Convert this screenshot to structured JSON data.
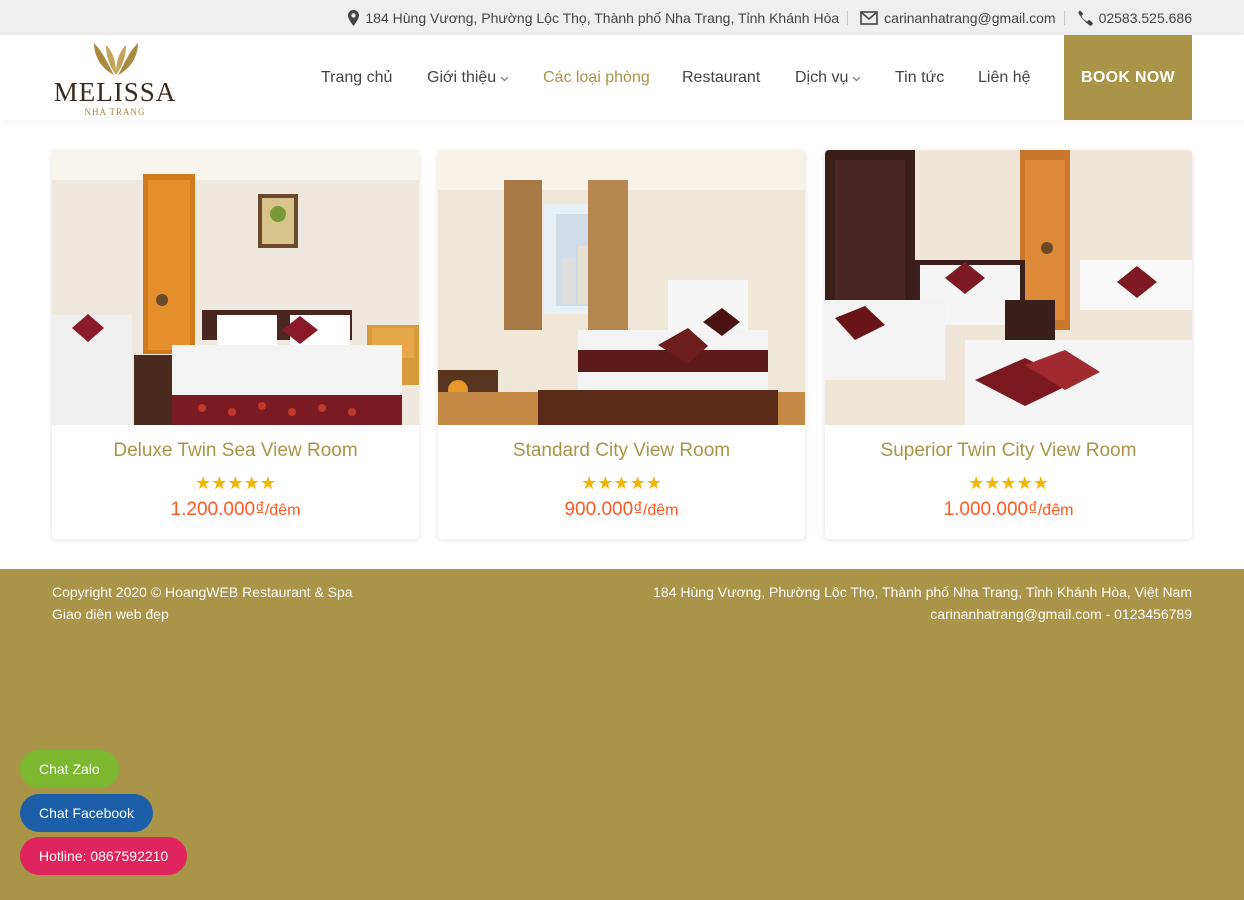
{
  "topbar": {
    "address": "184 Hùng Vương, Phường Lộc Thọ, Thành phố Nha Trang, Tỉnh Khánh Hòa",
    "email": "carinanhatrang@gmail.com",
    "phone": "02583.525.686",
    "icons": [
      "map-marker-icon",
      "envelope-icon",
      "phone-icon"
    ]
  },
  "logo": {
    "name": "MELISSA",
    "subtitle": "NHA TRANG"
  },
  "nav": {
    "items": [
      {
        "label": "Trang chủ",
        "active": false,
        "dropdown": false
      },
      {
        "label": "Giới thiệu",
        "active": false,
        "dropdown": true
      },
      {
        "label": "Các loại phòng",
        "active": true,
        "dropdown": false
      },
      {
        "label": "Restaurant",
        "active": false,
        "dropdown": false
      },
      {
        "label": "Dịch vụ",
        "active": false,
        "dropdown": true
      },
      {
        "label": "Tin tức",
        "active": false,
        "dropdown": false
      },
      {
        "label": "Liên hệ",
        "active": false,
        "dropdown": false
      }
    ],
    "book_label": "BOOK NOW"
  },
  "rooms": [
    {
      "title": "Deluxe Twin Sea View Room",
      "rating": 5,
      "max_rating": 5,
      "price": "1.200.000₫",
      "unit": "/đêm"
    },
    {
      "title": "Standard City View Room",
      "rating": 5,
      "max_rating": 5,
      "price": "900.000₫",
      "unit": "/đêm"
    },
    {
      "title": "Superior Twin City View Room",
      "rating": 5,
      "max_rating": 5,
      "price": "1.000.000₫",
      "unit": "/đêm"
    }
  ],
  "footer": {
    "copyright": "Copyright 2020 © HoangWEB Restaurant & Spa",
    "tagline": "Giao diện web đẹp",
    "address": "184 Hùng Vương, Phường Lộc Thọ, Thành phố Nha Trang, Tỉnh Khánh Hòa, Việt Nam",
    "contact": "carinanhatrang@gmail.com - 0123456789"
  },
  "chat": {
    "zalo": "Chat Zalo",
    "facebook": "Chat Facebook",
    "hotline": "Hotline: 0867592210"
  },
  "colors": {
    "accent": "#aa9447",
    "price": "#ff5722",
    "star": "#f3b500",
    "zalo": "#7cb82f",
    "facebook": "#1c5fa8",
    "hotline": "#e0245e"
  }
}
